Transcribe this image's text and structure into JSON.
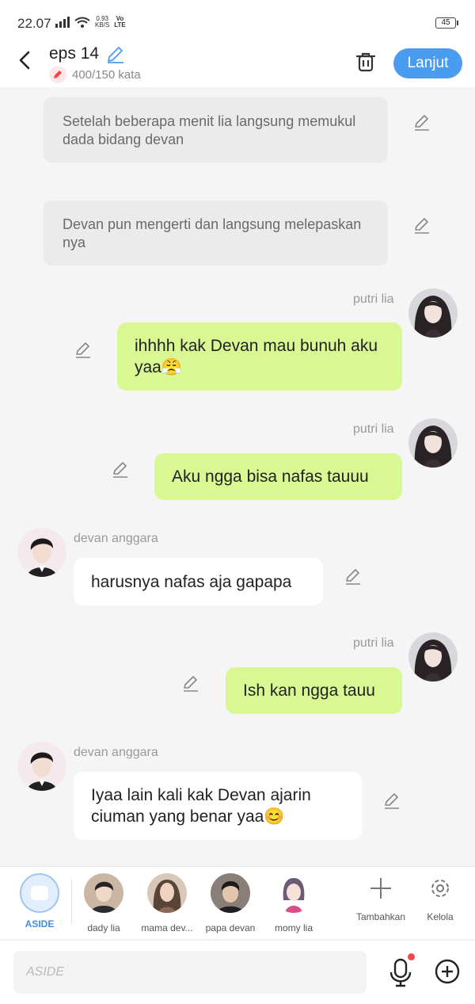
{
  "status_bar": {
    "time": "22.07",
    "net_speed": "0.93",
    "net_unit": "KB/S",
    "volte": "Vo",
    "lte": "LTE",
    "battery": "45"
  },
  "header": {
    "title": "eps 14",
    "word_count": "400/150 kata",
    "next_label": "Lanjut"
  },
  "messages": {
    "narration_1": "Setelah beberapa menit lia langsung memukul dada bidang devan",
    "narration_2": "Devan pun mengerti dan langsung melepaskan nya",
    "msg_3": {
      "sender": "putri lia",
      "text": "ihhhh kak Devan mau bunuh aku yaa😤"
    },
    "msg_4": {
      "sender": "putri lia",
      "text": "Aku ngga bisa nafas tauuu"
    },
    "msg_5": {
      "sender": "devan anggara",
      "text": "harusnya nafas aja gapapa"
    },
    "msg_6": {
      "sender": "putri lia",
      "text": "Ish kan ngga tauu"
    },
    "msg_7": {
      "sender": "devan anggara",
      "text": "Iyaa lain kali kak Devan ajarin ciuman yang benar yaa😊"
    }
  },
  "characters": {
    "aside": "ASIDE",
    "c1": "dady lia",
    "c2": "mama dev...",
    "c3": "papa devan",
    "c4": "momy lia",
    "add": "Tambahkan",
    "manage": "Kelola"
  },
  "input": {
    "placeholder": "ASIDE"
  },
  "colors": {
    "accent": "#4a9cf0",
    "right_bubble": "#d9f793",
    "narration_bg": "#ebebeb"
  }
}
